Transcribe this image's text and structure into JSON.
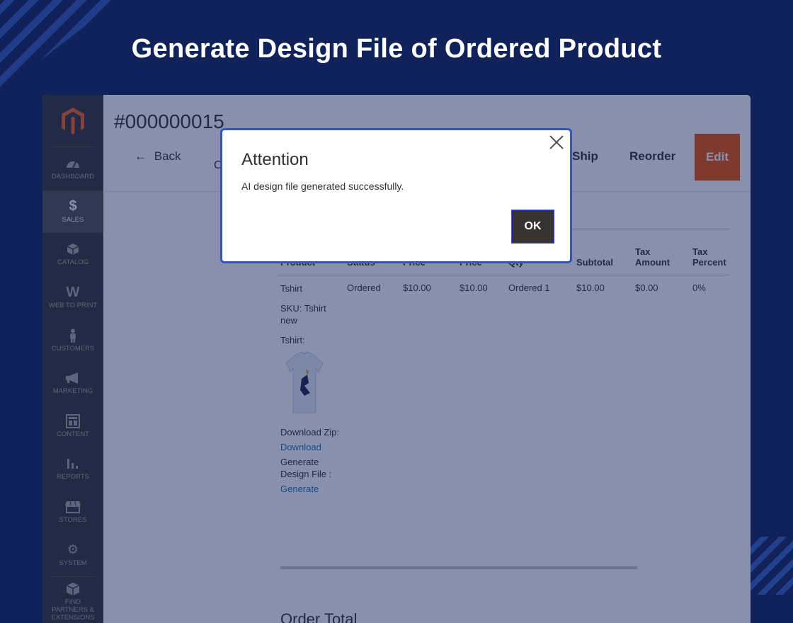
{
  "banner": {
    "title": "Generate Design File of Ordered Product"
  },
  "sidebar": {
    "items": [
      {
        "label": "DASHBOARD",
        "icon": "dashboard-icon"
      },
      {
        "label": "SALES",
        "icon": "dollar-icon"
      },
      {
        "label": "CATALOG",
        "icon": "box-icon"
      },
      {
        "label": "WEB TO PRINT",
        "icon": "w-logo-icon"
      },
      {
        "label": "CUSTOMERS",
        "icon": "person-icon"
      },
      {
        "label": "MARKETING",
        "icon": "megaphone-icon"
      },
      {
        "label": "CONTENT",
        "icon": "layout-icon"
      },
      {
        "label": "REPORTS",
        "icon": "bar-chart-icon"
      },
      {
        "label": "STORES",
        "icon": "storefront-icon"
      },
      {
        "label": "SYSTEM",
        "icon": "gear-icon"
      },
      {
        "label": "FIND PARTNERS & EXTENSIONS",
        "icon": "cubes-icon"
      }
    ]
  },
  "page": {
    "order_id": "#000000015",
    "toolbar": {
      "back": "Back",
      "partial": "C",
      "ship": "Ship",
      "reorder": "Reorder",
      "edit": "Edit"
    }
  },
  "items_table": {
    "headers": {
      "product": "Product",
      "status": "Status",
      "price1": "Price",
      "price2": "Price",
      "qty": "Qty",
      "subtotal": "Subtotal",
      "tax_amount": "Tax Amount",
      "tax_percent": "Tax Percent"
    },
    "row": {
      "product": "Tshirt",
      "sku": "SKU: Tshirt new",
      "option_label": "Tshirt:",
      "download_label": "Download Zip:",
      "download_link": "Download",
      "generate_label": "Generate Design File :",
      "generate_link": "Generate",
      "status": "Ordered",
      "price1": "$10.00",
      "price2": "$10.00",
      "qty": "Ordered 1",
      "subtotal": "$10.00",
      "tax_amount": "$0.00",
      "tax_percent": "0%"
    }
  },
  "order_total": "Order Total",
  "modal": {
    "title": "Attention",
    "message": "AI design file generated successfully.",
    "ok": "OK"
  },
  "colors": {
    "banner_bg": "#112159",
    "modal_border": "#2f54d3",
    "edit_button": "#eb5202",
    "link": "#1979c3",
    "sidebar_bg": "#373330"
  }
}
